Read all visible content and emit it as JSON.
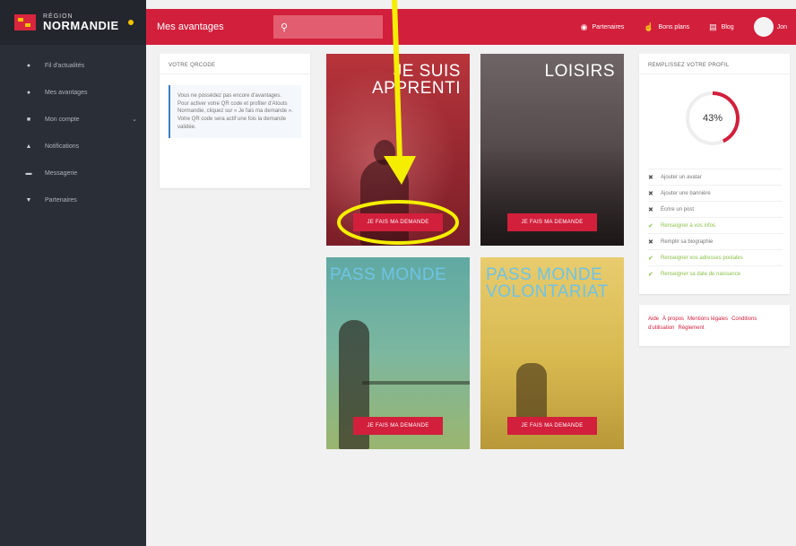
{
  "brand": {
    "small": "RÉGION",
    "big": "NORMANDIE"
  },
  "sidebar": {
    "items": [
      {
        "label": "Fil d'actualités",
        "icon": "home-icon"
      },
      {
        "label": "Mes avantages",
        "icon": "star-icon"
      },
      {
        "label": "Mon compte",
        "icon": "user-icon"
      },
      {
        "label": "Notifications",
        "icon": "bell-icon"
      },
      {
        "label": "Messagerie",
        "icon": "mail-icon"
      },
      {
        "label": "Partenaires",
        "icon": "pin-icon"
      }
    ]
  },
  "header": {
    "title": "Mes avantages",
    "links": [
      {
        "label": "Partenaires",
        "icon": "pin-icon"
      },
      {
        "label": "Bons plans",
        "icon": "thumbs-up-icon"
      },
      {
        "label": "Blog",
        "icon": "blog-icon"
      }
    ],
    "user": "Jon"
  },
  "qrcode": {
    "title": "VOTRE QRCODE",
    "text": "Vous ne possédez pas encore d'avantages. Pour activer votre QR code et profiter d'Atouts Normandie, cliquez sur « Je fais ma demande ». Votre QR code sera actif une fois la demande validée."
  },
  "tiles": [
    {
      "title_line1": "JE SUIS",
      "title_line2": "APPRENTI",
      "button": "JE FAIS MA DEMANDE"
    },
    {
      "title_line1": "LOISIRS",
      "title_line2": "",
      "button": "JE FAIS MA DEMANDE"
    },
    {
      "title_line1": "PASS MONDE",
      "title_line2": "",
      "button": "JE FAIS MA DEMANDE"
    },
    {
      "title_line1": "PASS MONDE",
      "title_line2": "VOLONTARIAT",
      "button": "JE FAIS MA DEMANDE"
    }
  ],
  "profile": {
    "title": "REMPLISSEZ VOTRE PROFIL",
    "percent_label": "43%",
    "percent_value": 0.43,
    "items": [
      {
        "label": "Ajouter un avatar",
        "done": false
      },
      {
        "label": "Ajouter une bannière",
        "done": false
      },
      {
        "label": "Écrire un post",
        "done": false
      },
      {
        "label": "Renseigner à vos infos",
        "done": true
      },
      {
        "label": "Remplir sa biographie",
        "done": false
      },
      {
        "label": "Renseigner vos adresses postales",
        "done": true
      },
      {
        "label": "Renseigner sa date de naissance",
        "done": true
      }
    ]
  },
  "footer_links": [
    "Aide",
    "À propos",
    "Mentions légales",
    "Conditions d'utilisation",
    "Règlement"
  ],
  "colors": {
    "accent": "#d21f3c",
    "sidebar": "#2a2e36",
    "annotation": "#f5ee00"
  }
}
